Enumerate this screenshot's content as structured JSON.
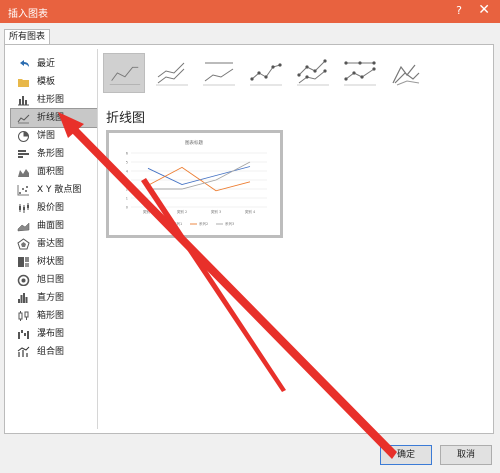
{
  "window": {
    "title": "插入图表",
    "help_label": "?",
    "close_label": "✕"
  },
  "tab": {
    "label": "所有图表"
  },
  "sidebar": {
    "items": [
      {
        "label": "最近",
        "icon": "undo-icon"
      },
      {
        "label": "模板",
        "icon": "folder-icon"
      },
      {
        "label": "柱形图",
        "icon": "column-chart-icon"
      },
      {
        "label": "折线图",
        "icon": "line-chart-icon",
        "selected": true
      },
      {
        "label": "饼图",
        "icon": "pie-chart-icon"
      },
      {
        "label": "条形图",
        "icon": "bar-chart-icon"
      },
      {
        "label": "面积图",
        "icon": "area-chart-icon"
      },
      {
        "label": "X Y 散点图",
        "icon": "scatter-chart-icon"
      },
      {
        "label": "股价图",
        "icon": "stock-chart-icon"
      },
      {
        "label": "曲面图",
        "icon": "surface-chart-icon"
      },
      {
        "label": "雷达图",
        "icon": "radar-chart-icon"
      },
      {
        "label": "树状图",
        "icon": "treemap-chart-icon"
      },
      {
        "label": "旭日图",
        "icon": "sunburst-chart-icon"
      },
      {
        "label": "直方图",
        "icon": "histogram-chart-icon"
      },
      {
        "label": "箱形图",
        "icon": "box-whisker-chart-icon"
      },
      {
        "label": "瀑布图",
        "icon": "waterfall-chart-icon"
      },
      {
        "label": "组合图",
        "icon": "combo-chart-icon"
      }
    ]
  },
  "main": {
    "heading": "折线图",
    "subtypes": [
      "line",
      "stacked-line",
      "100-stacked-line",
      "line-markers",
      "stacked-line-markers",
      "100-stacked-line-markers",
      "3d-line"
    ],
    "preview": {
      "title": "图表标题",
      "y_ticks": [
        "6",
        "5",
        "4",
        "3",
        "2",
        "1",
        "0"
      ],
      "categories": [
        "类别 1",
        "类别 2",
        "类别 3",
        "类别 4"
      ],
      "legend": [
        "系列1",
        "系列2",
        "系列3"
      ]
    }
  },
  "chart_data": {
    "type": "line",
    "title": "图表标题",
    "categories": [
      "类别 1",
      "类别 2",
      "类别 3",
      "类别 4"
    ],
    "ylim": [
      0,
      6
    ],
    "series": [
      {
        "name": "系列1",
        "values": [
          4.3,
          2.5,
          3.5,
          4.5
        ]
      },
      {
        "name": "系列2",
        "values": [
          2.4,
          4.4,
          1.8,
          2.8
        ]
      },
      {
        "name": "系列3",
        "values": [
          2,
          2,
          3,
          5
        ]
      }
    ],
    "colors": [
      "#4472c4",
      "#ed7d31",
      "#a5a5a5"
    ],
    "legend_position": "bottom",
    "grid": true
  },
  "footer": {
    "ok_label": "确定",
    "cancel_label": "取消"
  },
  "annotation": {
    "color": "#e8302a"
  }
}
